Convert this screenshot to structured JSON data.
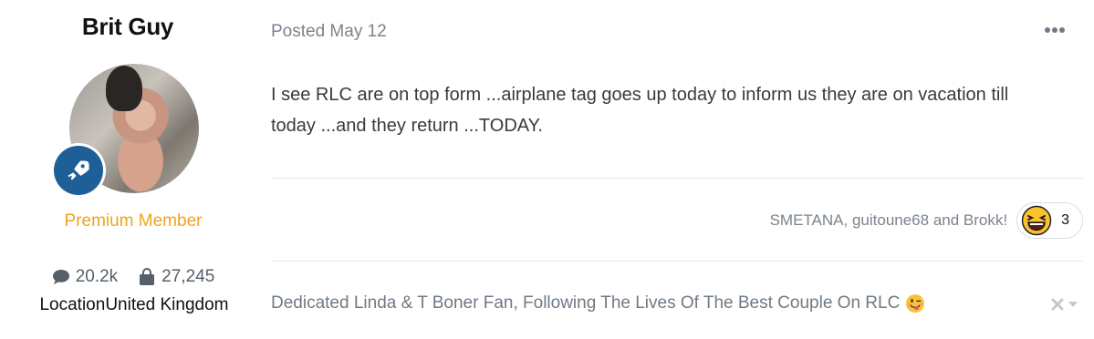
{
  "author": {
    "name": "Brit Guy",
    "rank": "Premium Member",
    "posts": "20.2k",
    "points": "27,245",
    "location_label": "Location",
    "location_value": "United Kingdom"
  },
  "post": {
    "posted": "Posted May 12",
    "body": "I see RLC are on top form ...airplane tag goes up today to inform us they are on vacation till today ...and they return ...TODAY."
  },
  "reactions": {
    "names": "SMETANA, guitoune68 and Brokk!",
    "count": "3",
    "emoji": "laughing-face-icon"
  },
  "signature": {
    "text": "Dedicated Linda & T Boner Fan, Following The Lives Of The Best Couple On RLC"
  },
  "colors": {
    "rank": "#f0a419",
    "badge": "#1f5f97",
    "muted": "#7a838d"
  }
}
